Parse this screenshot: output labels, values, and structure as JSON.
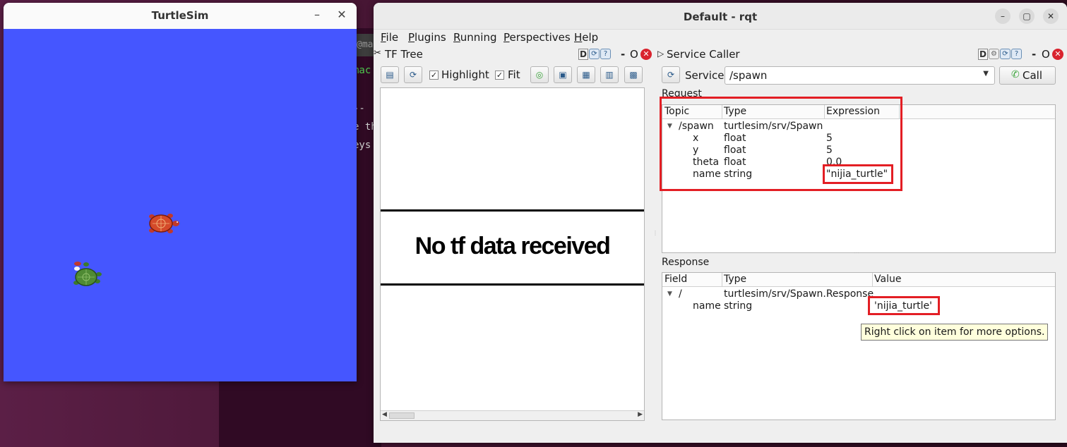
{
  "terminal": {
    "tab_text": "@machi",
    "lines": [
      "mac",
      "--",
      "e th",
      "eys"
    ]
  },
  "turtlesim": {
    "title": "TurtleSim",
    "minimize": "–",
    "close": "✕",
    "background_color": "#4556ff"
  },
  "rqt": {
    "title": "Default - rqt",
    "window_buttons": {
      "minimize": "–",
      "maximize": "▢",
      "close": "✕"
    },
    "menu": [
      {
        "label": "File",
        "mnemonic": "F",
        "rest": "ile"
      },
      {
        "label": "Plugins",
        "mnemonic": "P",
        "rest": "lugins"
      },
      {
        "label": "Running",
        "mnemonic": "R",
        "rest": "unning"
      },
      {
        "label": "Perspectives",
        "mnemonic": "P",
        "rest": "erspectives"
      },
      {
        "label": "Help",
        "mnemonic": "H",
        "rest": "elp"
      }
    ],
    "tf_tree": {
      "title": "TF Tree",
      "highlight_label": "Highlight",
      "fit_label": "Fit",
      "highlight_checked": true,
      "fit_checked": true,
      "message": "No tf data received",
      "dock_d": "D",
      "dock_dash": "-",
      "dock_o": "O",
      "dock_x": "✕"
    },
    "service_caller": {
      "title": "Service Caller",
      "service_label": "Service",
      "service_value": "/spawn",
      "call_label": "Call",
      "request_label": "Request",
      "request_columns": [
        "Topic",
        "Type",
        "Expression"
      ],
      "request_rows": [
        {
          "topic": "/spawn",
          "type": "turtlesim/srv/Spawn",
          "expression": "",
          "expanded": true
        },
        {
          "topic": "x",
          "type": "float",
          "expression": "5"
        },
        {
          "topic": "y",
          "type": "float",
          "expression": "5"
        },
        {
          "topic": "theta",
          "type": "float",
          "expression": "0.0"
        },
        {
          "topic": "name",
          "type": "string",
          "expression": "\"nijia_turtle\""
        }
      ],
      "response_label": "Response",
      "response_columns": [
        "Field",
        "Type",
        "Value"
      ],
      "response_rows": [
        {
          "field": "/",
          "type": "turtlesim/srv/Spawn.Response",
          "value": "",
          "expanded": true
        },
        {
          "field": "name",
          "type": "string",
          "value": "'nijia_turtle'"
        }
      ],
      "tooltip": "Right click on item for more options.",
      "dock_d": "D",
      "dock_dash": "-",
      "dock_o": "O",
      "dock_x": "✕"
    },
    "highlight_color": "#e31e24"
  }
}
